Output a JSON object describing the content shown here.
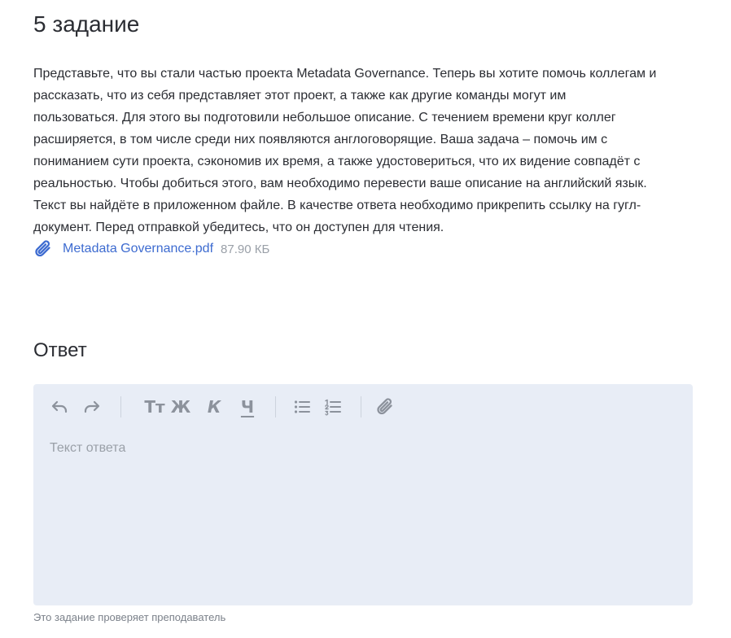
{
  "task": {
    "title": "5 задание",
    "description_lines": [
      "Представьте, что вы стали частью проекта Metadata Governance. Теперь вы хотите помочь коллегам и",
      "рассказать, что из себя представляет этот проект, а также как другие команды могут им",
      "пользоваться. Для этого вы подготовили небольшое описание. С течением времени круг коллег",
      "расширяется, в том числе среди них появляются англоговорящие. Ваша задача – помочь им с",
      "пониманием сути проекта, сэкономив их время, а также удостовериться, что их видение совпадёт с",
      "реальностью. Чтобы добиться этого, вам необходимо перевести ваше описание на английский язык.",
      "Текст вы найдёте в приложенном файле. В качестве ответа необходимо прикрепить ссылку на гугл-",
      "документ. Перед отправкой убедитесь, что он доступен для чтения."
    ],
    "attachment": {
      "name": "Metadata Governance.pdf",
      "size": "87.90 КБ",
      "icon": "paperclip-icon",
      "color": "#3d6bd0"
    }
  },
  "answer": {
    "title": "Ответ",
    "placeholder": "Текст ответа",
    "value": "",
    "toolbar": {
      "text_size_label": "Тт",
      "bold_label": "Ж",
      "italic_label": "К",
      "underline_label": "Ч",
      "icons": [
        "undo-icon",
        "redo-icon",
        "bulleted-list-icon",
        "numbered-list-icon",
        "attach-icon"
      ]
    },
    "background": "#e8edf6"
  },
  "footer": {
    "note": "Это задание проверяет преподаватель"
  }
}
